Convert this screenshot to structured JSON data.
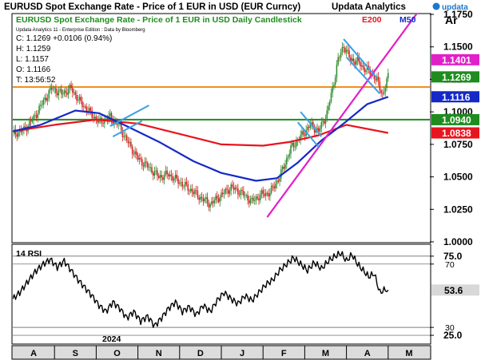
{
  "header": {
    "title": "EURUSD Spot Exchange Rate - Price of 1 EUR in USD (EUR Curncy)",
    "brand": "Updata Analytics",
    "logo_text": "updata",
    "axis_tag": "Ar"
  },
  "price_panel": {
    "subtitle": "EURUSD Spot Exchange Rate - Price of 1 EUR in USD Daily Candlestick",
    "legend": [
      {
        "name": "E200",
        "color": "#e8141e"
      },
      {
        "name": "M50",
        "color": "#1528c8"
      }
    ],
    "info_line": "Updata Analytics 11 - Enterprise Edition : Data by Bloomberg",
    "ohlc": [
      "C: 1.1269  +0.0106 (0.94%)",
      "H: 1.1259",
      "L: 1.1157",
      "O: 1.1166",
      "T: 13:56:52"
    ]
  },
  "rsi_panel": {
    "label": "14 RSI"
  },
  "colors": {
    "candle_up": "#2e8b2e",
    "candle_down": "#d42020",
    "ema200": "#e8141e",
    "ma50": "#1528c8",
    "trend_magenta": "#e020c8",
    "channel_blue": "#3aa0e8",
    "orange_line": "#f0901e",
    "green_line": "#1e8c1e",
    "tag_magenta": "#e020c8",
    "tag_green": "#1e8c1e",
    "tag_blue": "#1528c8",
    "tag_red": "#e8141e"
  },
  "chart_data": [
    {
      "type": "candlestick",
      "title": "EURUSD Spot Exchange Rate - Price of 1 EUR in USD Daily Candlestick",
      "xlabel": "",
      "ylabel": "",
      "ylim": [
        1.0,
        1.175
      ],
      "y_ticks": [
        1.0,
        1.025,
        1.05,
        1.075,
        1.1,
        1.125,
        1.15,
        1.175
      ],
      "y_tick_labels": [
        "1.0000",
        "1.0250",
        "1.0500",
        "1.0750",
        "1.1000",
        "1.1250",
        "1.1500",
        "1.1750"
      ],
      "months": [
        "A",
        "S",
        "O",
        "N",
        "D",
        "J",
        "F",
        "M",
        "A",
        "M"
      ],
      "year_label": "2024",
      "price_path": [
        [
          0,
          1.083
        ],
        [
          8,
          1.086
        ],
        [
          15,
          1.095
        ],
        [
          22,
          1.108
        ],
        [
          28,
          1.118
        ],
        [
          35,
          1.114
        ],
        [
          42,
          1.118
        ],
        [
          48,
          1.108
        ],
        [
          55,
          1.1
        ],
        [
          62,
          1.092
        ],
        [
          70,
          1.096
        ],
        [
          76,
          1.09
        ],
        [
          82,
          1.078
        ],
        [
          90,
          1.064
        ],
        [
          97,
          1.058
        ],
        [
          105,
          1.05
        ],
        [
          112,
          1.052
        ],
        [
          120,
          1.046
        ],
        [
          128,
          1.04
        ],
        [
          135,
          1.034
        ],
        [
          142,
          1.029
        ],
        [
          150,
          1.036
        ],
        [
          157,
          1.042
        ],
        [
          164,
          1.038
        ],
        [
          172,
          1.031
        ],
        [
          178,
          1.036
        ],
        [
          185,
          1.038
        ],
        [
          192,
          1.05
        ],
        [
          200,
          1.072
        ],
        [
          208,
          1.082
        ],
        [
          214,
          1.09
        ],
        [
          220,
          1.085
        ],
        [
          226,
          1.099
        ],
        [
          230,
          1.118
        ],
        [
          234,
          1.14
        ],
        [
          238,
          1.151
        ],
        [
          243,
          1.14
        ],
        [
          248,
          1.139
        ],
        [
          252,
          1.134
        ],
        [
          258,
          1.13
        ],
        [
          262,
          1.124
        ],
        [
          266,
          1.113
        ],
        [
          270,
          1.127
        ]
      ],
      "series": [
        {
          "name": "E200",
          "points": [
            [
              0,
              1.085
            ],
            [
              30,
              1.09
            ],
            [
              60,
              1.094
            ],
            [
              90,
              1.091
            ],
            [
              120,
              1.083
            ],
            [
              150,
              1.075
            ],
            [
              180,
              1.074
            ],
            [
              200,
              1.077
            ],
            [
              220,
              1.082
            ],
            [
              240,
              1.09
            ],
            [
              270,
              1.0838
            ]
          ]
        },
        {
          "name": "M50",
          "points": [
            [
              0,
              1.085
            ],
            [
              20,
              1.09
            ],
            [
              45,
              1.101
            ],
            [
              62,
              1.099
            ],
            [
              80,
              1.09
            ],
            [
              105,
              1.077
            ],
            [
              130,
              1.062
            ],
            [
              150,
              1.053
            ],
            [
              175,
              1.047
            ],
            [
              190,
              1.049
            ],
            [
              205,
              1.061
            ],
            [
              222,
              1.078
            ],
            [
              238,
              1.091
            ],
            [
              255,
              1.106
            ],
            [
              270,
              1.1116
            ]
          ]
        }
      ],
      "horizontal_levels": [
        {
          "value": 1.1191,
          "color_key": "orange_line"
        },
        {
          "value": 1.094,
          "color_key": "green_line"
        }
      ],
      "trendlines": [
        {
          "name": "up-trend",
          "from": [
            183,
            1.019
          ],
          "to": [
            295,
            1.182
          ],
          "color_key": "trend_magenta"
        },
        {
          "name": "channel-1-upper",
          "from": [
            70,
            1.089
          ],
          "to": [
            98,
            1.105
          ],
          "color_key": "channel_blue"
        },
        {
          "name": "channel-1-lower",
          "from": [
            72,
            1.081
          ],
          "to": [
            93,
            1.093
          ],
          "color_key": "channel_blue"
        },
        {
          "name": "channel-2-upper",
          "from": [
            205,
            1.092
          ],
          "to": [
            220,
            1.073
          ],
          "color_key": "channel_blue"
        },
        {
          "name": "channel-2-lower",
          "from": [
            207,
            1.1
          ],
          "to": [
            222,
            1.081
          ],
          "color_key": "channel_blue"
        },
        {
          "name": "channel-3-upper",
          "from": [
            238,
            1.156
          ],
          "to": [
            262,
            1.126
          ],
          "color_key": "channel_blue"
        },
        {
          "name": "channel-3-lower",
          "from": [
            240,
            1.142
          ],
          "to": [
            264,
            1.114
          ],
          "color_key": "channel_blue"
        }
      ],
      "value_tags": [
        {
          "label": "1.1401",
          "value": 1.1401,
          "color_key": "tag_magenta"
        },
        {
          "label": "1.1269",
          "value": 1.1269,
          "color_key": "tag_green"
        },
        {
          "label": "1.1116",
          "value": 1.1116,
          "color_key": "tag_blue"
        },
        {
          "label": "1.0940",
          "value": 1.094,
          "color_key": "tag_green"
        },
        {
          "label": "1.0838",
          "value": 1.0838,
          "color_key": "tag_red"
        }
      ],
      "grid": false
    },
    {
      "type": "line",
      "title": "14 RSI",
      "ylim": [
        20,
        82
      ],
      "y_ticks": [
        25,
        30,
        70,
        75
      ],
      "y_tick_labels": [
        "25.0",
        "30",
        "70",
        "75.0"
      ],
      "levels": [
        25,
        30,
        70,
        75
      ],
      "last_value_label": "53.6",
      "last_value": 53.6,
      "x_max": 270,
      "points": [
        [
          0,
          48
        ],
        [
          5,
          52
        ],
        [
          10,
          58
        ],
        [
          16,
          65
        ],
        [
          22,
          70
        ],
        [
          27,
          73
        ],
        [
          32,
          68
        ],
        [
          37,
          72
        ],
        [
          42,
          66
        ],
        [
          47,
          60
        ],
        [
          52,
          55
        ],
        [
          57,
          50
        ],
        [
          62,
          44
        ],
        [
          67,
          40
        ],
        [
          72,
          46
        ],
        [
          77,
          42
        ],
        [
          82,
          36
        ],
        [
          87,
          40
        ],
        [
          92,
          34
        ],
        [
          97,
          37
        ],
        [
          102,
          31
        ],
        [
          107,
          36
        ],
        [
          112,
          42
        ],
        [
          117,
          46
        ],
        [
          122,
          40
        ],
        [
          127,
          43
        ],
        [
          132,
          38
        ],
        [
          137,
          44
        ],
        [
          142,
          40
        ],
        [
          147,
          47
        ],
        [
          152,
          52
        ],
        [
          157,
          48
        ],
        [
          162,
          45
        ],
        [
          167,
          50
        ],
        [
          172,
          47
        ],
        [
          177,
          52
        ],
        [
          182,
          57
        ],
        [
          187,
          60
        ],
        [
          192,
          66
        ],
        [
          197,
          70
        ],
        [
          202,
          74
        ],
        [
          207,
          70
        ],
        [
          212,
          66
        ],
        [
          217,
          71
        ],
        [
          222,
          67
        ],
        [
          227,
          72
        ],
        [
          232,
          75
        ],
        [
          236,
          77
        ],
        [
          240,
          72
        ],
        [
          244,
          76
        ],
        [
          248,
          70
        ],
        [
          252,
          66
        ],
        [
          256,
          62
        ],
        [
          260,
          64
        ],
        [
          264,
          52
        ],
        [
          268,
          54
        ],
        [
          270,
          53.6
        ]
      ]
    }
  ]
}
